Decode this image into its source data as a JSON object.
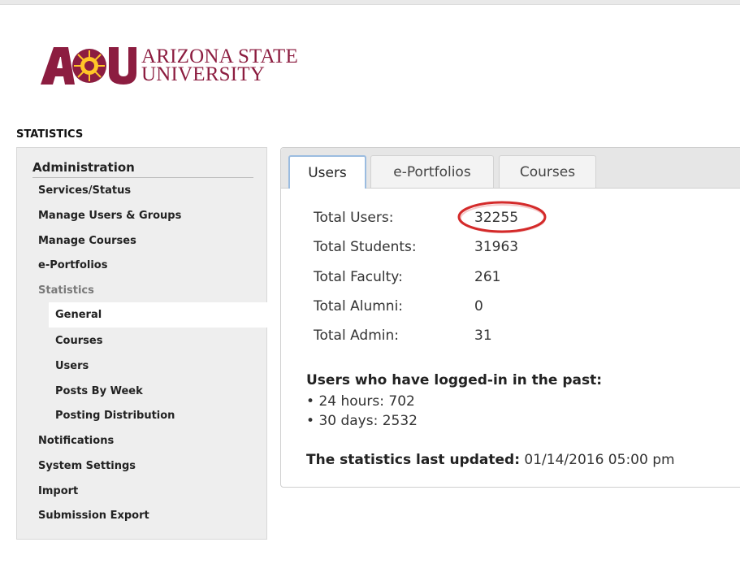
{
  "logo": {
    "mark": "ASU",
    "line1": "ARIZONA STATE",
    "line2": "UNIVERSITY"
  },
  "section_title": "STATISTICS",
  "sidebar": {
    "heading": "Administration",
    "items": [
      {
        "label": "Services/Status"
      },
      {
        "label": "Manage Users & Groups"
      },
      {
        "label": "Manage Courses"
      },
      {
        "label": "e-Portfolios"
      },
      {
        "label": "Statistics"
      },
      {
        "label": "General"
      },
      {
        "label": "Courses"
      },
      {
        "label": "Users"
      },
      {
        "label": "Posts By Week"
      },
      {
        "label": "Posting Distribution"
      },
      {
        "label": "Notifications"
      },
      {
        "label": "System Settings"
      },
      {
        "label": "Import"
      },
      {
        "label": "Submission Export"
      }
    ]
  },
  "tabs": [
    {
      "label": "Users"
    },
    {
      "label": "e-Portfolios"
    },
    {
      "label": "Courses"
    }
  ],
  "stats": [
    {
      "label": "Total Users:",
      "value": "32255"
    },
    {
      "label": "Total Students:",
      "value": "31963"
    },
    {
      "label": "Total Faculty:",
      "value": "261"
    },
    {
      "label": "Total Alumni:",
      "value": "0"
    },
    {
      "label": "Total Admin:",
      "value": "31"
    }
  ],
  "logged_in": {
    "heading": "Users who have logged-in in the past:",
    "items": [
      {
        "text": "24 hours: 702"
      },
      {
        "text": "30 days: 2532"
      }
    ]
  },
  "last_updated": {
    "label": "The statistics last updated:",
    "value": "01/14/2016 05:00 pm"
  },
  "colors": {
    "brand_maroon": "#8c1d40",
    "brand_gold": "#ffc627",
    "annotation_circle": "#d42a2a",
    "active_tab_border": "#9bbce0"
  }
}
